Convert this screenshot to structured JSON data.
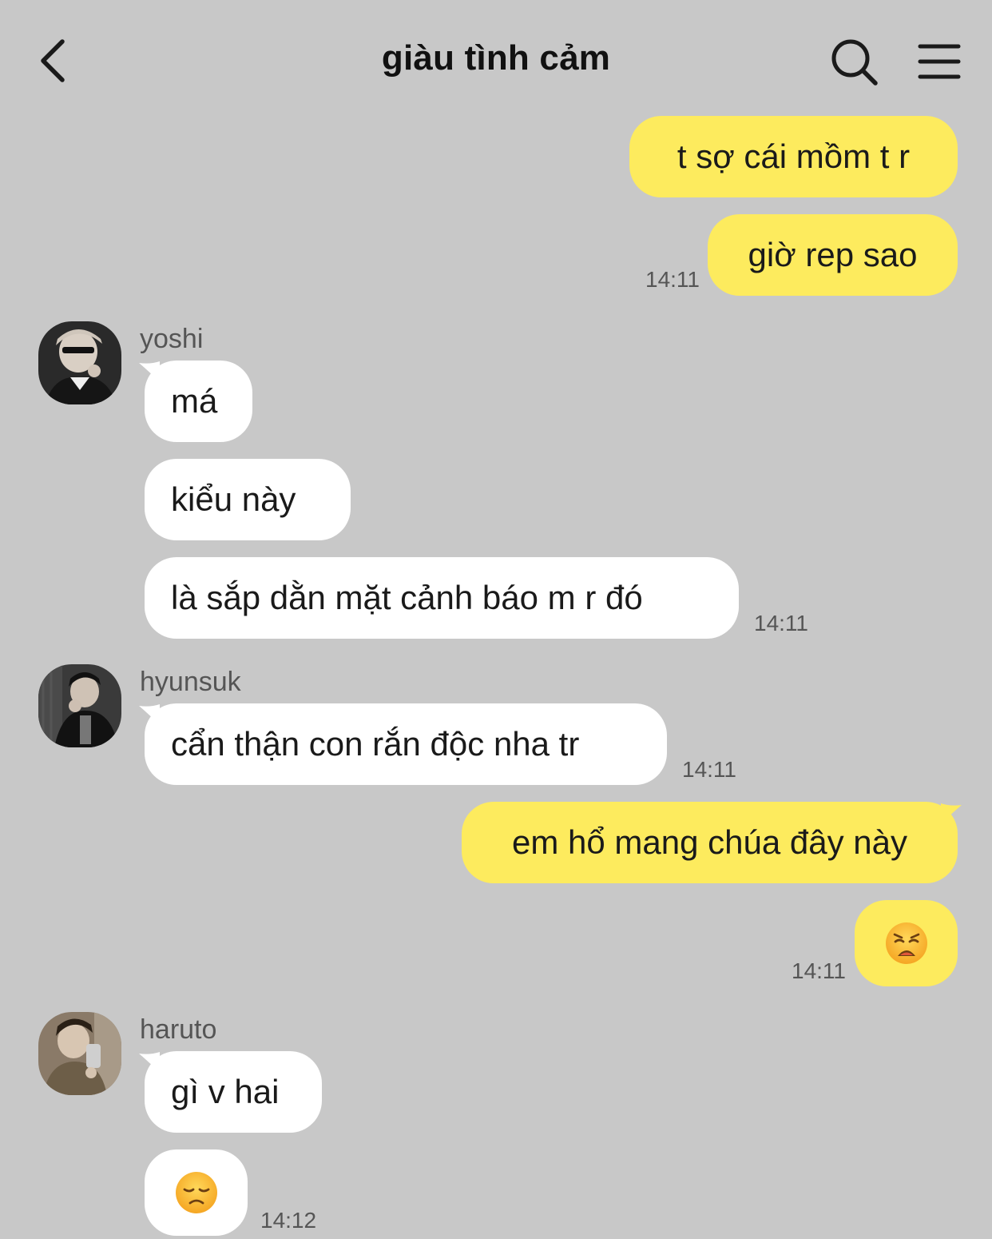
{
  "header": {
    "title": "giàu tình cảm",
    "back_icon": "chevron-left-icon",
    "search_icon": "search-icon",
    "menu_icon": "menu-icon"
  },
  "colors": {
    "background": "#c8c8c8",
    "my_bubble": "#fdeb5e",
    "their_bubble": "#ffffff",
    "timestamp": "#555555"
  },
  "messages": [
    {
      "sender": "me",
      "text": "t sợ cái mồm t r"
    },
    {
      "sender": "me",
      "text": "giờ rep sao",
      "time": "14:11"
    },
    {
      "sender": "yoshi",
      "name": "yoshi",
      "text": "má"
    },
    {
      "sender": "yoshi",
      "text": "kiểu này"
    },
    {
      "sender": "yoshi",
      "text": "là sắp dằn mặt cảnh báo m r đó",
      "time": "14:11"
    },
    {
      "sender": "hyunsuk",
      "name": "hyunsuk",
      "text": "cẩn thận con rắn độc nha tr",
      "time": "14:11"
    },
    {
      "sender": "me",
      "text": "em hổ mang chúa đây này"
    },
    {
      "sender": "me",
      "emoji": "weary-face-emoji",
      "time": "14:11"
    },
    {
      "sender": "haruto",
      "name": "haruto",
      "text": "gì v hai"
    },
    {
      "sender": "haruto",
      "emoji": "disappointed-face-emoji",
      "time": "14:12"
    }
  ]
}
